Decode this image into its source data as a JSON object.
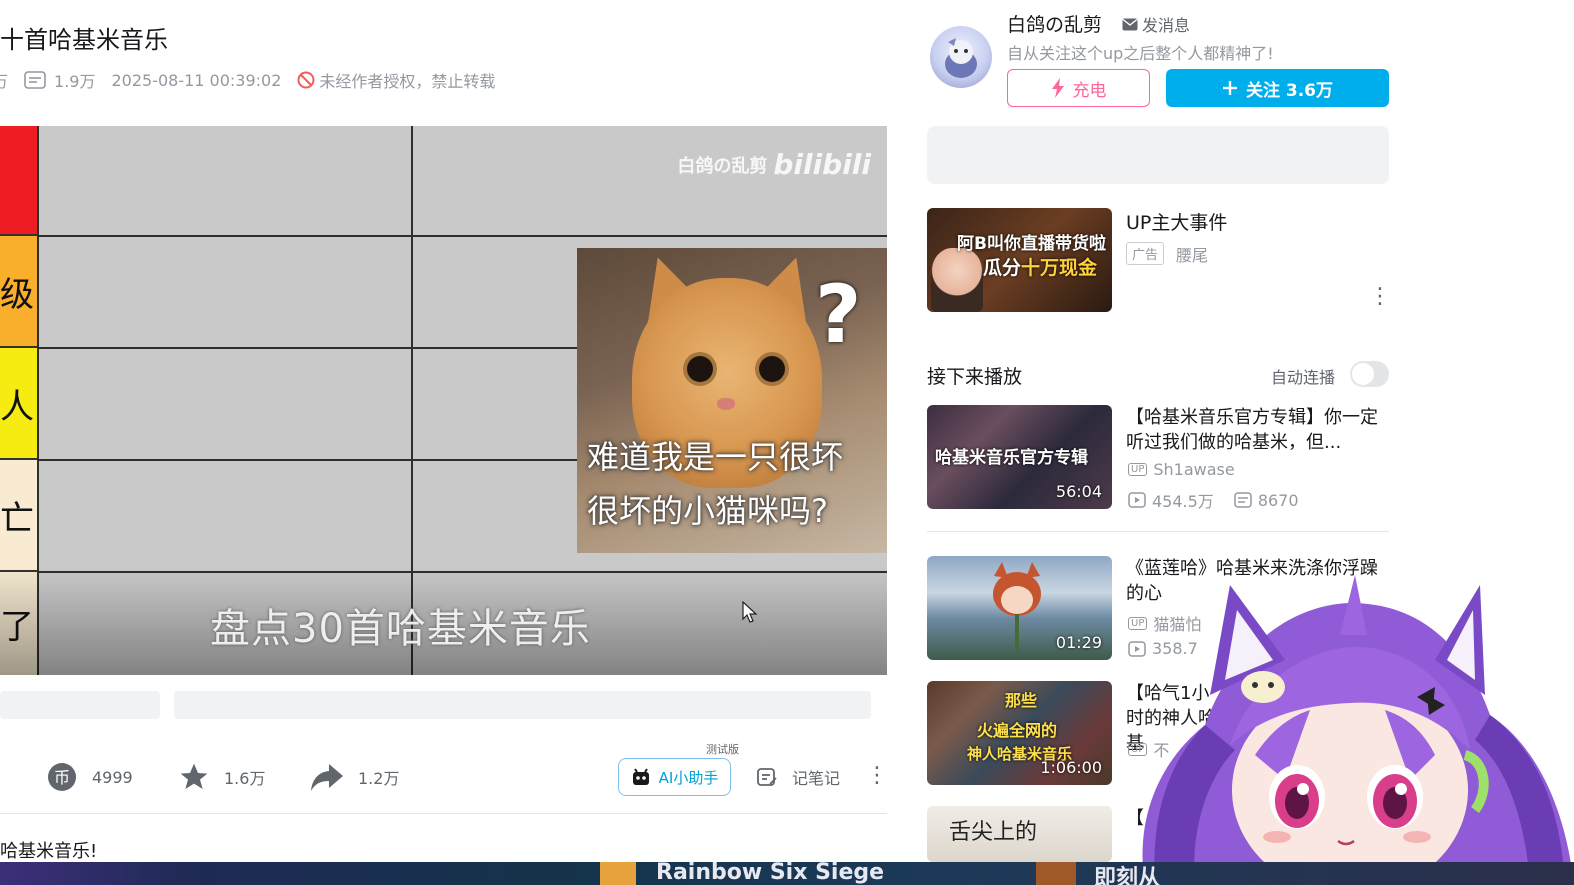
{
  "video": {
    "title": "十首哈基米音乐",
    "meta_prefix": "万",
    "views": "1.9万",
    "date": "2025-08-11 00:39:02",
    "no_reprint": "未经作者授权，禁止转载"
  },
  "player": {
    "tier_labels": [
      "",
      "级",
      "人",
      "亡",
      "了"
    ],
    "tier_colors": [
      "#ee1c23",
      "#f9ae2c",
      "#f7ec12",
      "#f8ebd1",
      "#f4e8d0"
    ],
    "watermark": "白鸽の乱剪",
    "watermark_logo": "bilibili",
    "cat_caption_line1": "难道我是一只很坏",
    "cat_caption_line2": "很坏的小猫咪吗?",
    "question_mark": "?",
    "subtitle": "盘点30首哈基米音乐"
  },
  "actions": {
    "coin_count": "4999",
    "favorite_count": "1.6万",
    "share_count": "1.2万",
    "ai_label": "AI小助手",
    "beta_label": "测试版",
    "notes_label": "记笔记"
  },
  "description": "哈基米音乐!",
  "uploader": {
    "name": "白鸽の乱剪",
    "message_label": "发消息",
    "bio": "自从关注这个up之后整个人都精神了!",
    "charge_label": "充电",
    "follow_label": "关注 3.6万"
  },
  "ad": {
    "thumb_line1": "阿B叫你直播带货啦",
    "thumb_line2_a": "瓜分",
    "thumb_line2_b": "十万现金",
    "title": "UP主大事件",
    "tag": "广告",
    "sub": "腰尾"
  },
  "next_up": {
    "label": "接下来播放",
    "autoplay_label": "自动连播",
    "items": [
      {
        "title": "【哈基米音乐官方专辑】你一定听过我们做的哈基米，但...",
        "uploader": "Sh1awase",
        "plays": "454.5万",
        "danmaku": "8670",
        "duration": "56:04",
        "thumb_text": "哈基米音乐官方专辑"
      },
      {
        "title": "《蓝莲哈》哈基米来洗涤你浮躁的心",
        "uploader": "猫猫怕",
        "plays": "358.7",
        "duration": "01:29"
      },
      {
        "title": "【哈气1小时的神人哈基",
        "uploader": "不",
        "duration": "1:06:00",
        "thumb_text_1": "那些",
        "thumb_text_2": "火遍全网的",
        "thumb_text_3": "神人哈基米音乐"
      },
      {
        "title": "【",
        "thumb_text": "舌尖上的"
      }
    ]
  },
  "taskbar": {
    "item1": "Rainbow Six Siege",
    "item2": "即刻从"
  },
  "colors": {
    "accent": "#00aeec",
    "charge_pink": "#ff6699",
    "text_secondary": "#9499a0"
  }
}
